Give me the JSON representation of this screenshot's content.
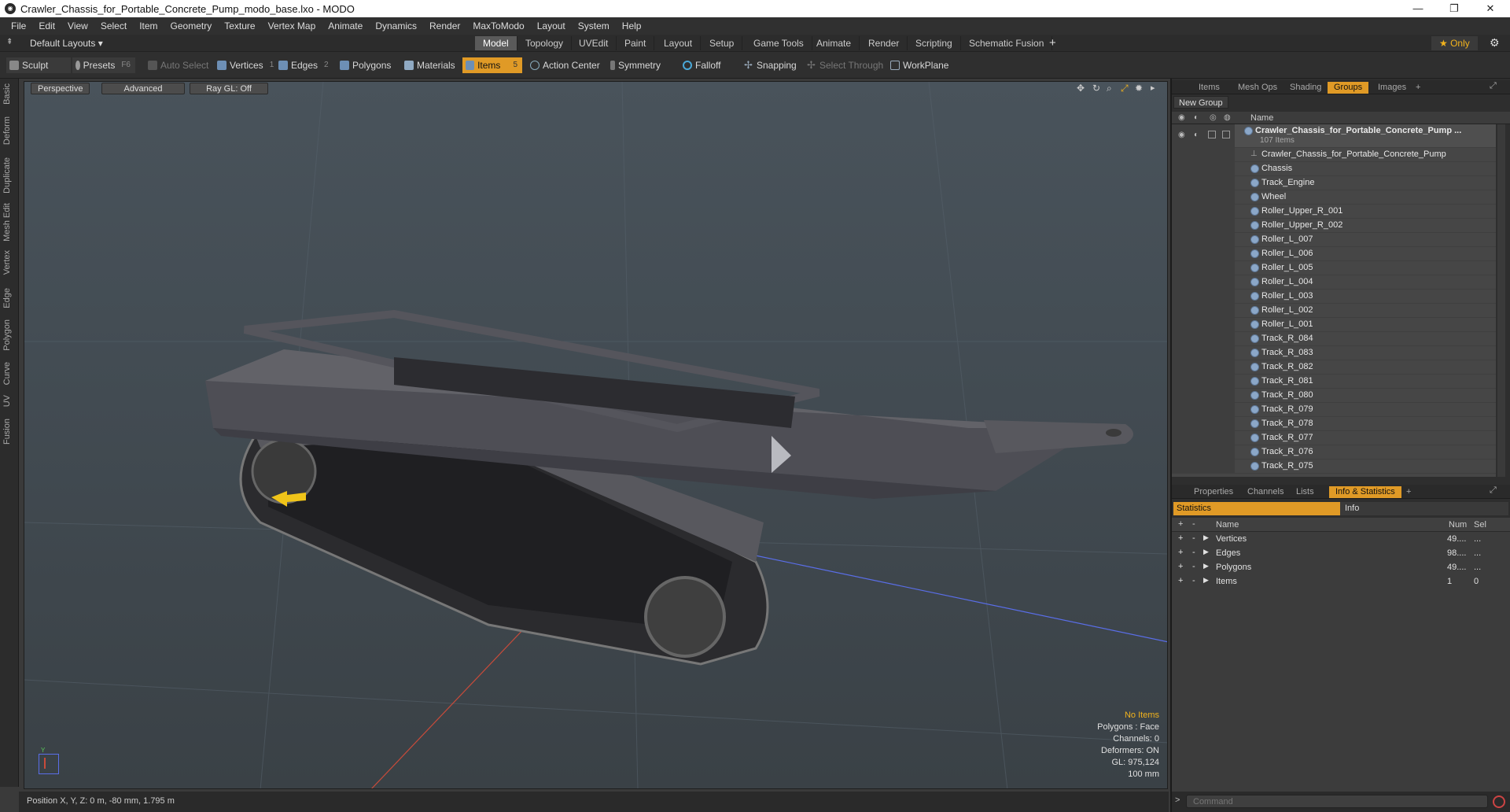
{
  "window": {
    "title": "Crawler_Chassis_for_Portable_Concrete_Pump_modo_base.lxo - MODO",
    "app_icon": "modo-icon",
    "minimize": "—",
    "restore": "❐",
    "close": "✕"
  },
  "menu": [
    "File",
    "Edit",
    "View",
    "Select",
    "Item",
    "Geometry",
    "Texture",
    "Vertex Map",
    "Animate",
    "Dynamics",
    "Render",
    "MaxToModo",
    "Layout",
    "System",
    "Help"
  ],
  "layout": {
    "preset": "Default Layouts",
    "tabs": [
      "Model",
      "Topology",
      "UVEdit",
      "Paint",
      "Layout",
      "Setup",
      "Game Tools",
      "Animate",
      "Render",
      "Scripting",
      "Schematic Fusion"
    ],
    "active_tab": "Model",
    "add": "+",
    "only_label": "★ Only",
    "gear": "⚙"
  },
  "toolbar": {
    "sculpt": "Sculpt",
    "presets": "Presets",
    "presets_key": "F6",
    "auto_select": "Auto Select",
    "vertices": "Vertices",
    "vertices_num": "1",
    "edges": "Edges",
    "edges_num": "2",
    "polygons": "Polygons",
    "materials": "Materials",
    "items": "Items",
    "items_num": "5",
    "action_center": "Action Center",
    "symmetry": "Symmetry",
    "falloff": "Falloff",
    "snapping": "Snapping",
    "select_through": "Select Through",
    "workplane": "WorkPlane"
  },
  "left_tabs": [
    "Basic",
    "Deform",
    "Duplicate",
    "Mesh Edit",
    "Vertex",
    "Edge",
    "Polygon",
    "Curve",
    "UV",
    "Fusion"
  ],
  "viewport": {
    "perspective": "Perspective",
    "advanced": "Advanced",
    "raygl": "Ray GL: Off",
    "info": {
      "no_items": "No Items",
      "polygons": "Polygons : Face",
      "channels": "Channels: 0",
      "deformers": "Deformers: ON",
      "gl": "GL: 975,124",
      "scale": "100 mm"
    }
  },
  "status": {
    "position": "Position X, Y, Z:  0 m, -80 mm, 1.795 m"
  },
  "top_panel": {
    "tabs": [
      "Items",
      "Mesh Ops",
      "Shading",
      "Groups",
      "Images"
    ],
    "active": "Groups",
    "add": "+",
    "new_group": "New Group",
    "name_header": "Name",
    "group": {
      "name": "Crawler_Chassis_for_Portable_Concrete_Pump ...",
      "count": "107 Items"
    },
    "items": [
      "Crawler_Chassis_for_Portable_Concrete_Pump",
      "Chassis",
      "Track_Engine",
      "Wheel",
      "Roller_Upper_R_001",
      "Roller_Upper_R_002",
      "Roller_L_007",
      "Roller_L_006",
      "Roller_L_005",
      "Roller_L_004",
      "Roller_L_003",
      "Roller_L_002",
      "Roller_L_001",
      "Track_R_084",
      "Track_R_083",
      "Track_R_082",
      "Track_R_081",
      "Track_R_080",
      "Track_R_079",
      "Track_R_078",
      "Track_R_077",
      "Track_R_076",
      "Track_R_075"
    ]
  },
  "bottom_panel": {
    "tabs": [
      "Properties",
      "Channels",
      "Lists",
      "Info & Statistics"
    ],
    "active": "Info & Statistics",
    "add": "+",
    "sub_tabs": [
      "Statistics",
      "Info"
    ],
    "headers": {
      "name": "Name",
      "num": "Num",
      "sel": "Sel"
    },
    "rows": [
      {
        "name": "Vertices",
        "num": "49....",
        "sel": "..."
      },
      {
        "name": "Edges",
        "num": "98....",
        "sel": "..."
      },
      {
        "name": "Polygons",
        "num": "49....",
        "sel": "..."
      },
      {
        "name": "Items",
        "num": "1",
        "sel": "0"
      }
    ]
  },
  "command": {
    "placeholder": "Command",
    "prompt": ">"
  },
  "colors": {
    "accent": "#e09a26",
    "highlight_text": "#f2b31d",
    "chassis": "#4e4e55",
    "track": "#2b2b2e"
  }
}
